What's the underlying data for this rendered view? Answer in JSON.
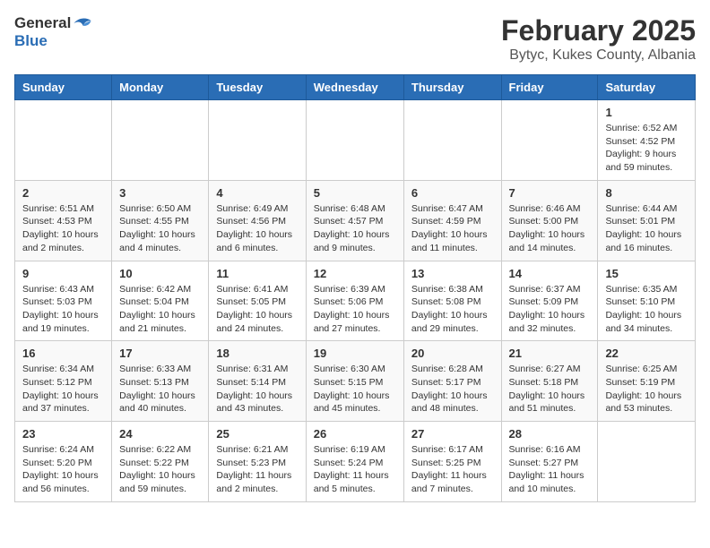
{
  "header": {
    "logo_general": "General",
    "logo_blue": "Blue",
    "title": "February 2025",
    "subtitle": "Bytyc, Kukes County, Albania"
  },
  "weekdays": [
    "Sunday",
    "Monday",
    "Tuesday",
    "Wednesday",
    "Thursday",
    "Friday",
    "Saturday"
  ],
  "weeks": [
    [
      {
        "day": "",
        "info": ""
      },
      {
        "day": "",
        "info": ""
      },
      {
        "day": "",
        "info": ""
      },
      {
        "day": "",
        "info": ""
      },
      {
        "day": "",
        "info": ""
      },
      {
        "day": "",
        "info": ""
      },
      {
        "day": "1",
        "info": "Sunrise: 6:52 AM\nSunset: 4:52 PM\nDaylight: 9 hours and 59 minutes."
      }
    ],
    [
      {
        "day": "2",
        "info": "Sunrise: 6:51 AM\nSunset: 4:53 PM\nDaylight: 10 hours and 2 minutes."
      },
      {
        "day": "3",
        "info": "Sunrise: 6:50 AM\nSunset: 4:55 PM\nDaylight: 10 hours and 4 minutes."
      },
      {
        "day": "4",
        "info": "Sunrise: 6:49 AM\nSunset: 4:56 PM\nDaylight: 10 hours and 6 minutes."
      },
      {
        "day": "5",
        "info": "Sunrise: 6:48 AM\nSunset: 4:57 PM\nDaylight: 10 hours and 9 minutes."
      },
      {
        "day": "6",
        "info": "Sunrise: 6:47 AM\nSunset: 4:59 PM\nDaylight: 10 hours and 11 minutes."
      },
      {
        "day": "7",
        "info": "Sunrise: 6:46 AM\nSunset: 5:00 PM\nDaylight: 10 hours and 14 minutes."
      },
      {
        "day": "8",
        "info": "Sunrise: 6:44 AM\nSunset: 5:01 PM\nDaylight: 10 hours and 16 minutes."
      }
    ],
    [
      {
        "day": "9",
        "info": "Sunrise: 6:43 AM\nSunset: 5:03 PM\nDaylight: 10 hours and 19 minutes."
      },
      {
        "day": "10",
        "info": "Sunrise: 6:42 AM\nSunset: 5:04 PM\nDaylight: 10 hours and 21 minutes."
      },
      {
        "day": "11",
        "info": "Sunrise: 6:41 AM\nSunset: 5:05 PM\nDaylight: 10 hours and 24 minutes."
      },
      {
        "day": "12",
        "info": "Sunrise: 6:39 AM\nSunset: 5:06 PM\nDaylight: 10 hours and 27 minutes."
      },
      {
        "day": "13",
        "info": "Sunrise: 6:38 AM\nSunset: 5:08 PM\nDaylight: 10 hours and 29 minutes."
      },
      {
        "day": "14",
        "info": "Sunrise: 6:37 AM\nSunset: 5:09 PM\nDaylight: 10 hours and 32 minutes."
      },
      {
        "day": "15",
        "info": "Sunrise: 6:35 AM\nSunset: 5:10 PM\nDaylight: 10 hours and 34 minutes."
      }
    ],
    [
      {
        "day": "16",
        "info": "Sunrise: 6:34 AM\nSunset: 5:12 PM\nDaylight: 10 hours and 37 minutes."
      },
      {
        "day": "17",
        "info": "Sunrise: 6:33 AM\nSunset: 5:13 PM\nDaylight: 10 hours and 40 minutes."
      },
      {
        "day": "18",
        "info": "Sunrise: 6:31 AM\nSunset: 5:14 PM\nDaylight: 10 hours and 43 minutes."
      },
      {
        "day": "19",
        "info": "Sunrise: 6:30 AM\nSunset: 5:15 PM\nDaylight: 10 hours and 45 minutes."
      },
      {
        "day": "20",
        "info": "Sunrise: 6:28 AM\nSunset: 5:17 PM\nDaylight: 10 hours and 48 minutes."
      },
      {
        "day": "21",
        "info": "Sunrise: 6:27 AM\nSunset: 5:18 PM\nDaylight: 10 hours and 51 minutes."
      },
      {
        "day": "22",
        "info": "Sunrise: 6:25 AM\nSunset: 5:19 PM\nDaylight: 10 hours and 53 minutes."
      }
    ],
    [
      {
        "day": "23",
        "info": "Sunrise: 6:24 AM\nSunset: 5:20 PM\nDaylight: 10 hours and 56 minutes."
      },
      {
        "day": "24",
        "info": "Sunrise: 6:22 AM\nSunset: 5:22 PM\nDaylight: 10 hours and 59 minutes."
      },
      {
        "day": "25",
        "info": "Sunrise: 6:21 AM\nSunset: 5:23 PM\nDaylight: 11 hours and 2 minutes."
      },
      {
        "day": "26",
        "info": "Sunrise: 6:19 AM\nSunset: 5:24 PM\nDaylight: 11 hours and 5 minutes."
      },
      {
        "day": "27",
        "info": "Sunrise: 6:17 AM\nSunset: 5:25 PM\nDaylight: 11 hours and 7 minutes."
      },
      {
        "day": "28",
        "info": "Sunrise: 6:16 AM\nSunset: 5:27 PM\nDaylight: 11 hours and 10 minutes."
      },
      {
        "day": "",
        "info": ""
      }
    ]
  ]
}
